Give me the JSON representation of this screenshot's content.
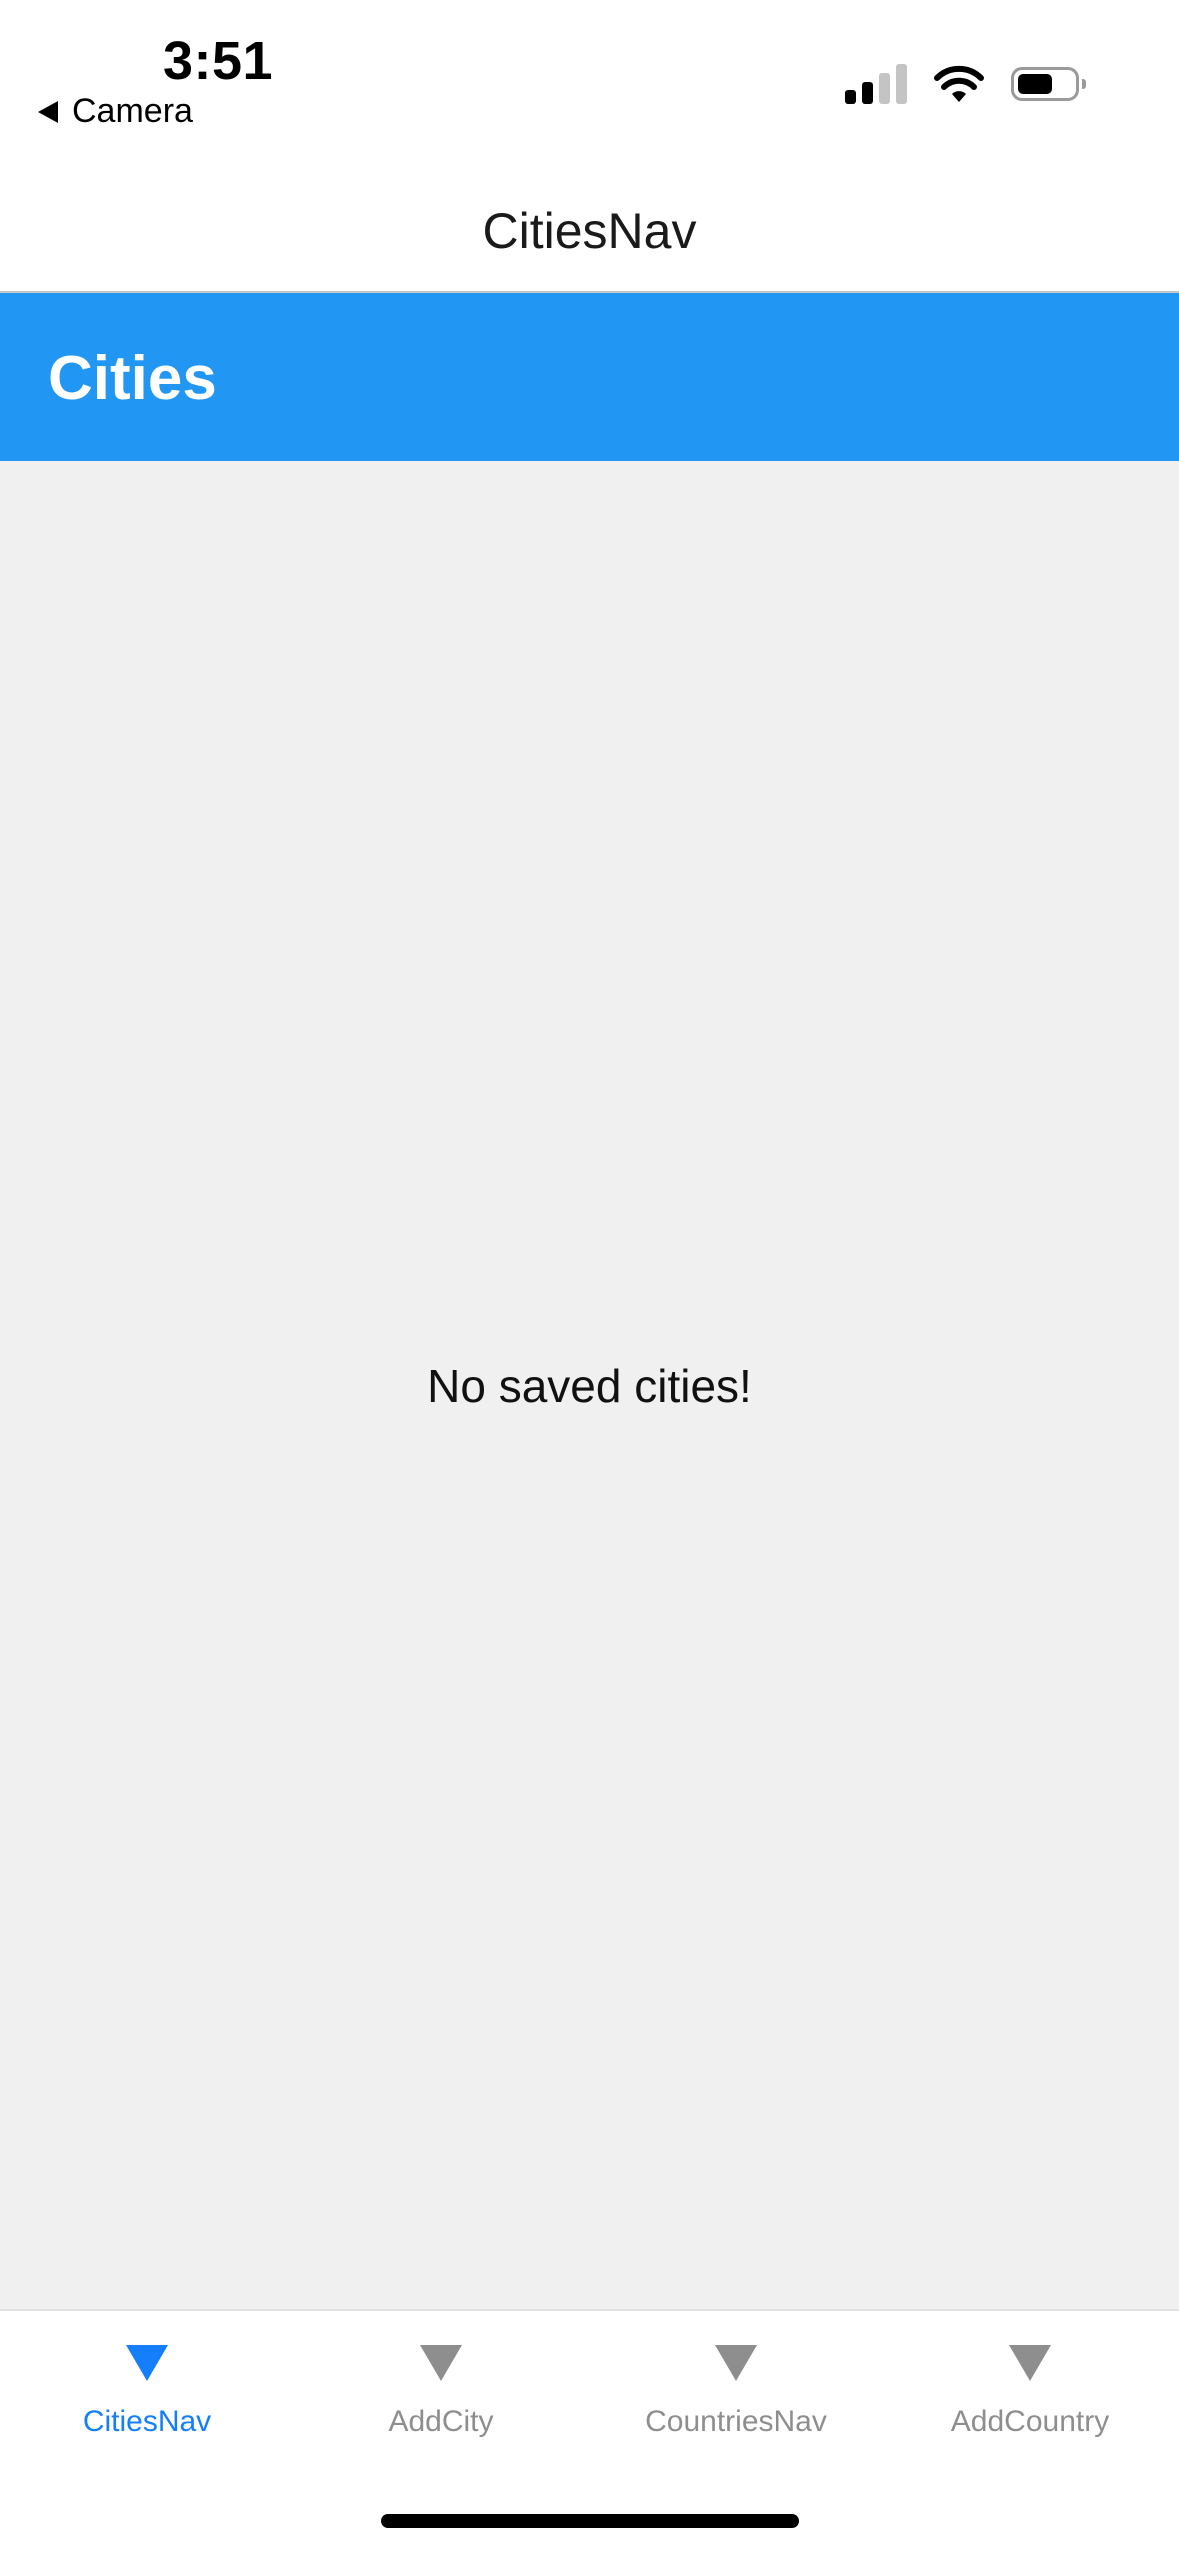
{
  "status_bar": {
    "time": "3:51",
    "back_label": "Camera"
  },
  "nav": {
    "title": "CitiesNav"
  },
  "header": {
    "title": "Cities"
  },
  "content": {
    "empty_message": "No saved cities!"
  },
  "tabs": [
    {
      "label": "CitiesNav",
      "active": true
    },
    {
      "label": "AddCity",
      "active": false
    },
    {
      "label": "CountriesNav",
      "active": false
    },
    {
      "label": "AddCountry",
      "active": false
    }
  ],
  "colors": {
    "header": "#2196F3",
    "tab_active": "#147EFB",
    "tab_inactive": "#8e8e8e",
    "content_background": "#f0f0f0"
  },
  "icons": {
    "tab_icon": "triangle-down-icon",
    "back": "back-triangle-icon",
    "signal": "cellular-signal-icon",
    "wifi": "wifi-icon",
    "battery": "battery-icon"
  }
}
